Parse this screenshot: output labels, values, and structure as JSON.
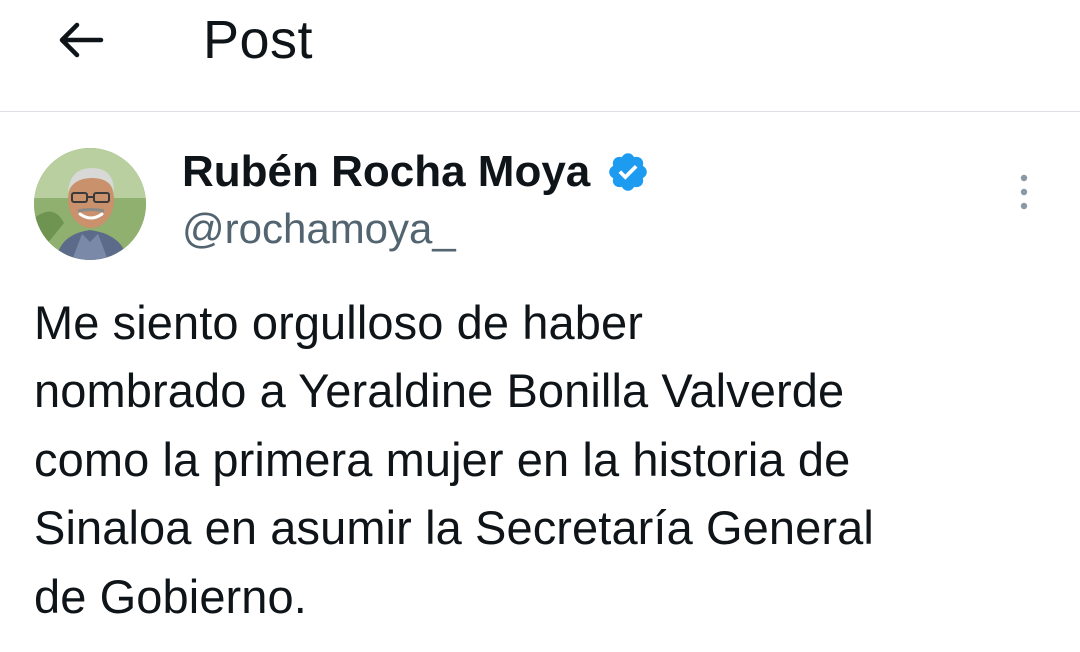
{
  "header": {
    "title": "Post",
    "back_icon": "arrow-left-icon"
  },
  "tweet": {
    "author": {
      "name": "Rubén Rocha Moya",
      "handle": "@rochamoya_",
      "verified": true,
      "verified_color": "#1d9bf0"
    },
    "more_icon": "more-vertical-icon",
    "text_lines": [
      "Me siento orgulloso de haber",
      "nombrado a Yeraldine Bonilla Valverde",
      "como la primera mujer en la historia de",
      "Sinaloa en asumir la Secretaría General",
      "de Gobierno."
    ]
  },
  "colors": {
    "text": "#0f1419",
    "secondary_text": "#536471",
    "divider": "#dcdfe3"
  }
}
